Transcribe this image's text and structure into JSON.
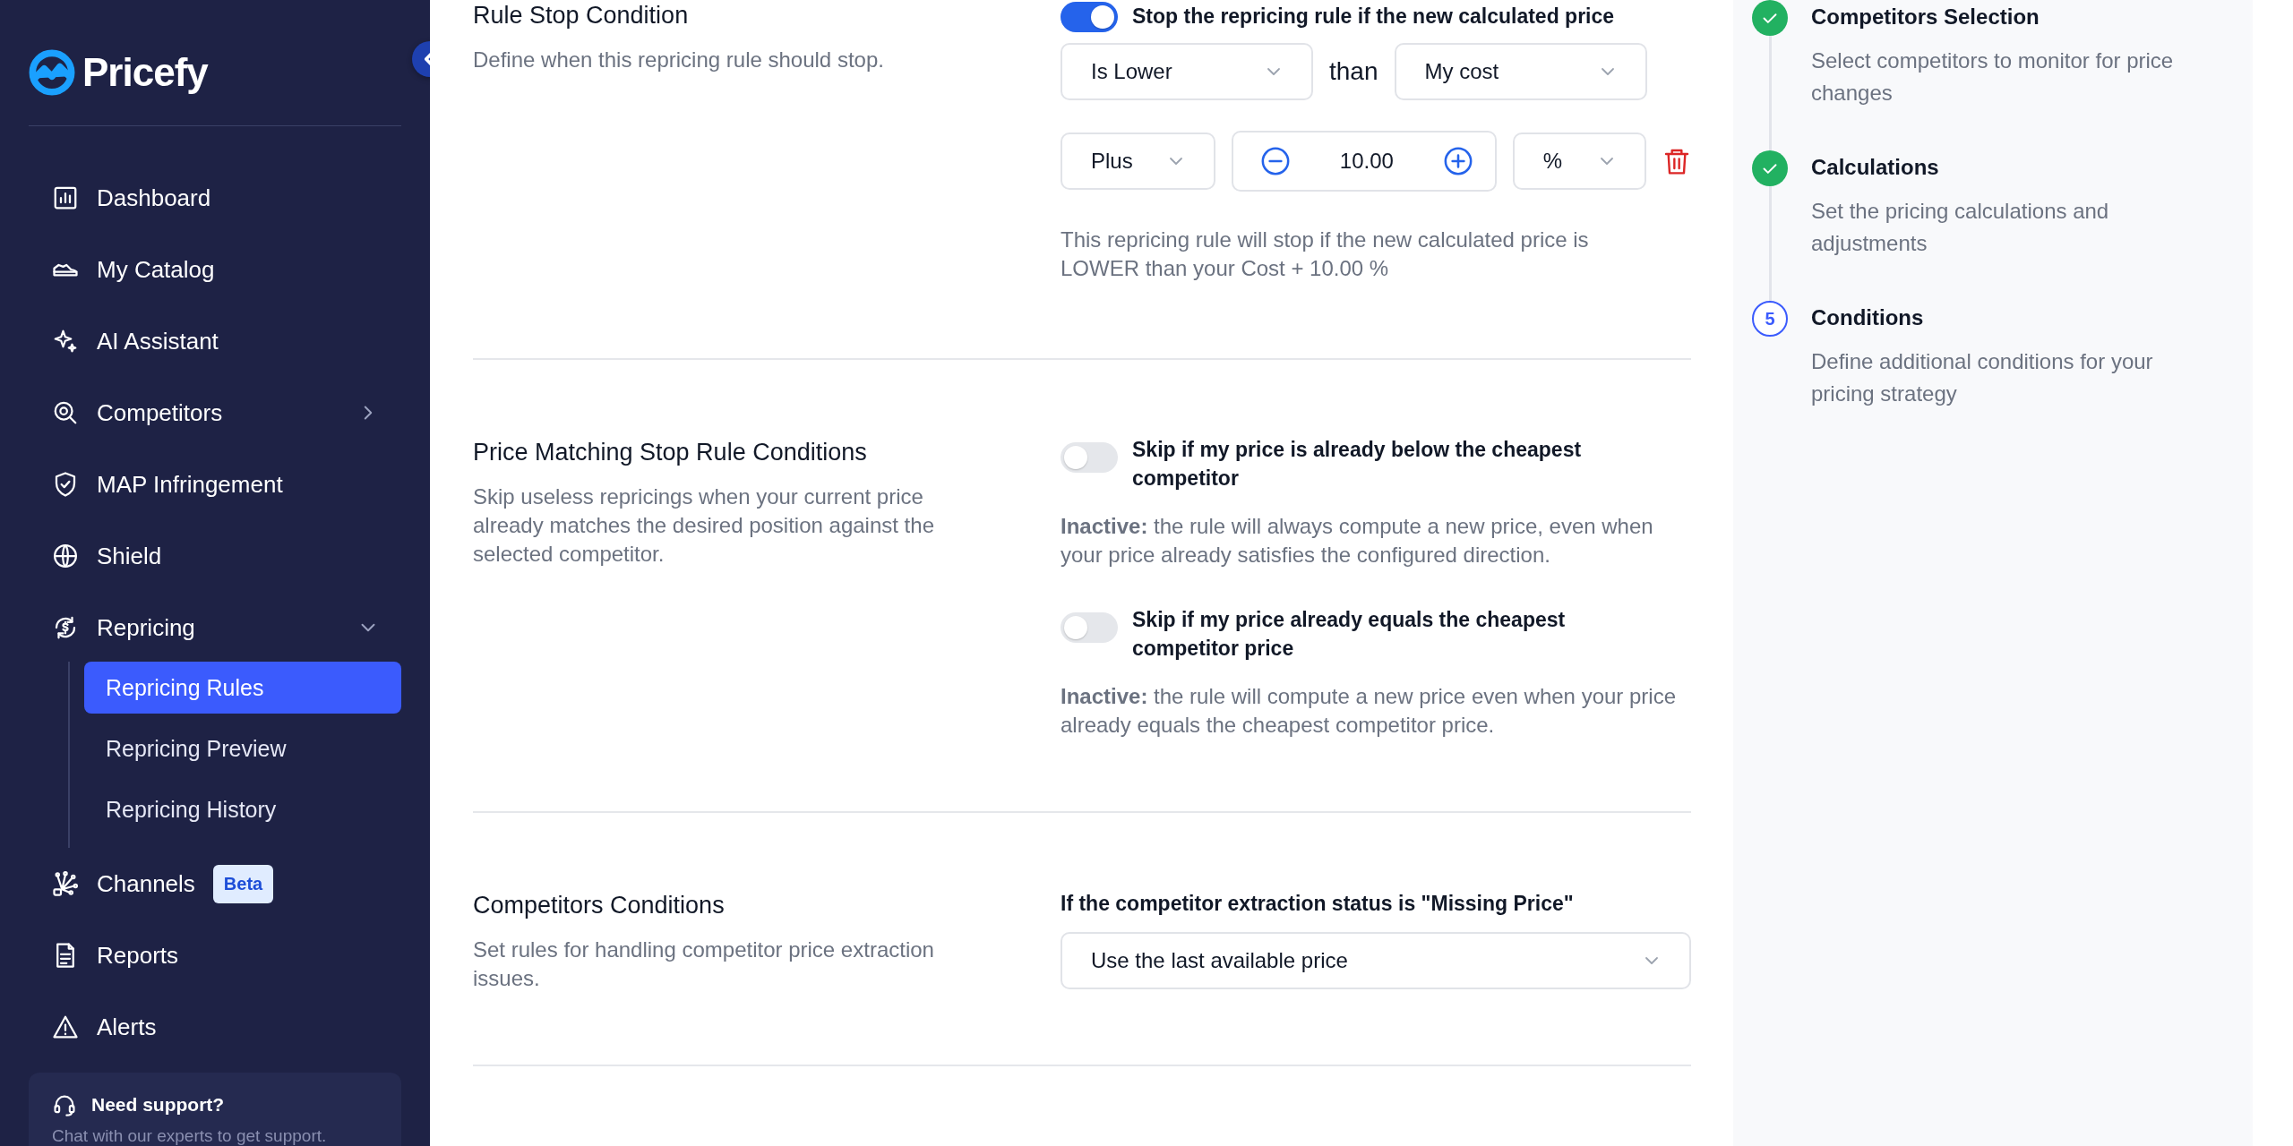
{
  "brand": {
    "name": "Pricefy"
  },
  "sidebar": {
    "items": [
      {
        "label": "Dashboard",
        "selected": false
      },
      {
        "label": "My Catalog",
        "selected": false
      },
      {
        "label": "AI Assistant",
        "selected": false
      },
      {
        "label": "Competitors",
        "selected": false,
        "expanded": false
      },
      {
        "label": "MAP Infringement",
        "selected": false
      },
      {
        "label": "Shield",
        "selected": false
      },
      {
        "label": "Repricing",
        "selected": false,
        "expanded": true,
        "children": [
          {
            "label": "Repricing Rules",
            "selected": true
          },
          {
            "label": "Repricing Preview",
            "selected": false
          },
          {
            "label": "Repricing History",
            "selected": false
          }
        ]
      },
      {
        "label": "Channels",
        "selected": false,
        "badge": "Beta"
      },
      {
        "label": "Reports",
        "selected": false
      },
      {
        "label": "Alerts",
        "selected": false
      }
    ],
    "support": {
      "title": "Need support?",
      "text": "Chat with our experts to get support."
    }
  },
  "sections": [
    {
      "kind": "stop",
      "title": "Rule Stop Condition",
      "description": "Define when this repricing rule should stop.",
      "toggle": {
        "label": "Stop the repricing rule if the new calculated price",
        "on": true
      },
      "operator": "Is Lower",
      "connector": "than",
      "reference": "My cost",
      "adjustment": "Plus",
      "amount": "10.00",
      "unit": "%",
      "summary": "This repricing rule will stop if the new calculated price is LOWER than your Cost + 10.00 %"
    },
    {
      "kind": "toggles",
      "title": "Price Matching Stop Rule Conditions",
      "description": "Skip useless repricings when your current price already matches the desired position against the selected competitor.",
      "options": [
        {
          "label": "Skip if my price is already below the cheapest competitor",
          "on": false,
          "note": "**Inactive:** the rule will always compute a new price, even when your price already satisfies the configured direction."
        },
        {
          "label": "Skip if my price already equals the cheapest competitor price",
          "on": false,
          "note": "**Inactive:** the rule will compute a new price even when your price already equals the cheapest competitor price."
        }
      ]
    },
    {
      "kind": "select",
      "title": "Competitors Conditions",
      "description": "Set rules for handling competitor price extraction issues.",
      "label": "If the competitor extraction status is \"Missing Price\"",
      "value": "Use the last available price"
    }
  ],
  "steps": [
    {
      "title": "Competitors Selection",
      "description": "Select competitors to monitor for price changes",
      "completed": true
    },
    {
      "title": "Calculations",
      "description": "Set the pricing calculations and adjustments",
      "completed": true
    },
    {
      "title": "Conditions",
      "description": "Define additional conditions for your pricing strategy",
      "completed": false,
      "number": "5"
    }
  ]
}
